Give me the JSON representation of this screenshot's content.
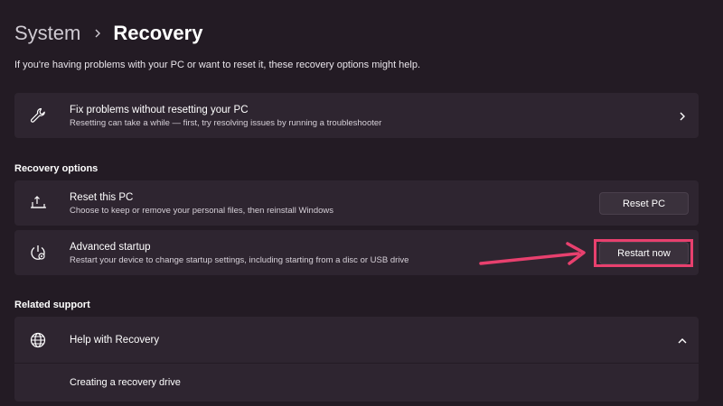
{
  "breadcrumb": {
    "parent": "System",
    "current": "Recovery"
  },
  "subtitle": "If you're having problems with your PC or want to reset it, these recovery options might help.",
  "fix_card": {
    "title": "Fix problems without resetting your PC",
    "description": "Resetting can take a while — first, try resolving issues by running a troubleshooter",
    "icon": "wrench-icon"
  },
  "recovery_options": {
    "label": "Recovery options",
    "items": [
      {
        "title": "Reset this PC",
        "description": "Choose to keep or remove your personal files, then reinstall Windows",
        "button": "Reset PC",
        "icon": "reset-pc-icon"
      },
      {
        "title": "Advanced startup",
        "description": "Restart your device to change startup settings, including starting from a disc or USB drive",
        "button": "Restart now",
        "icon": "advanced-startup-icon"
      }
    ]
  },
  "related_support": {
    "label": "Related support",
    "help_title": "Help with Recovery",
    "help_icon": "globe-icon",
    "links": [
      "Creating a recovery drive"
    ]
  },
  "colors": {
    "background": "#231b24",
    "card": "#2e2530",
    "accent_highlight": "#e8406e"
  }
}
